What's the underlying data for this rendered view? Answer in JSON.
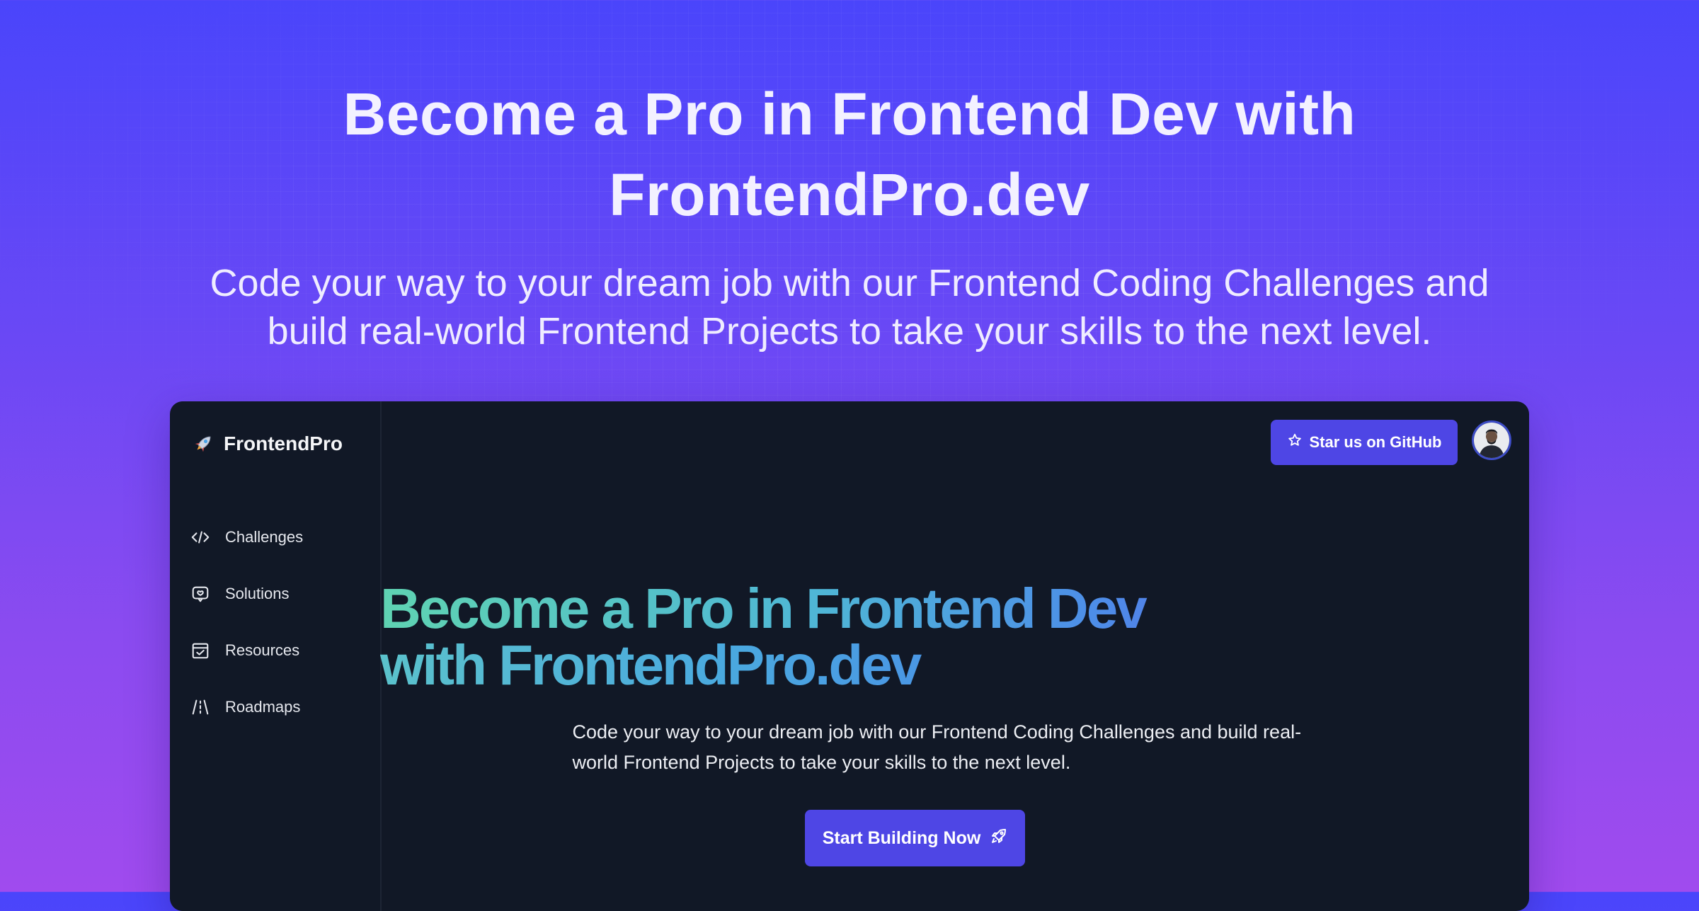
{
  "hero": {
    "title": "Become a Pro in Frontend Dev with FrontendPro.dev",
    "subtitle": "Code your way to your dream job with our Frontend Coding Challenges and build real-world Frontend Projects to take your skills to the next level."
  },
  "app": {
    "brand": {
      "icon": "rocket-icon",
      "name": "FrontendPro"
    },
    "sidebar": {
      "items": [
        {
          "label": "Challenges",
          "icon": "code-icon"
        },
        {
          "label": "Solutions",
          "icon": "message-icon"
        },
        {
          "label": "Resources",
          "icon": "calendar-check-icon"
        },
        {
          "label": "Roadmaps",
          "icon": "road-icon"
        }
      ]
    },
    "topbar": {
      "github_button": "Star us on GitHub",
      "github_icon": "star-icon",
      "avatar": "user-avatar"
    },
    "main": {
      "title_line1": "Become a Pro in Frontend Dev",
      "title_line2": "with FrontendPro.dev",
      "subtitle": "Code your way to your dream job with our Frontend Coding Challenges and build real-world Frontend Projects to take your skills to the next level.",
      "cta_label": "Start Building Now",
      "cta_icon": "rocket-icon"
    }
  },
  "colors": {
    "accent": "#4e46e5",
    "window_bg": "#111826",
    "gradient_start": "#5fd3b2",
    "gradient_end": "#7c4fe8"
  }
}
